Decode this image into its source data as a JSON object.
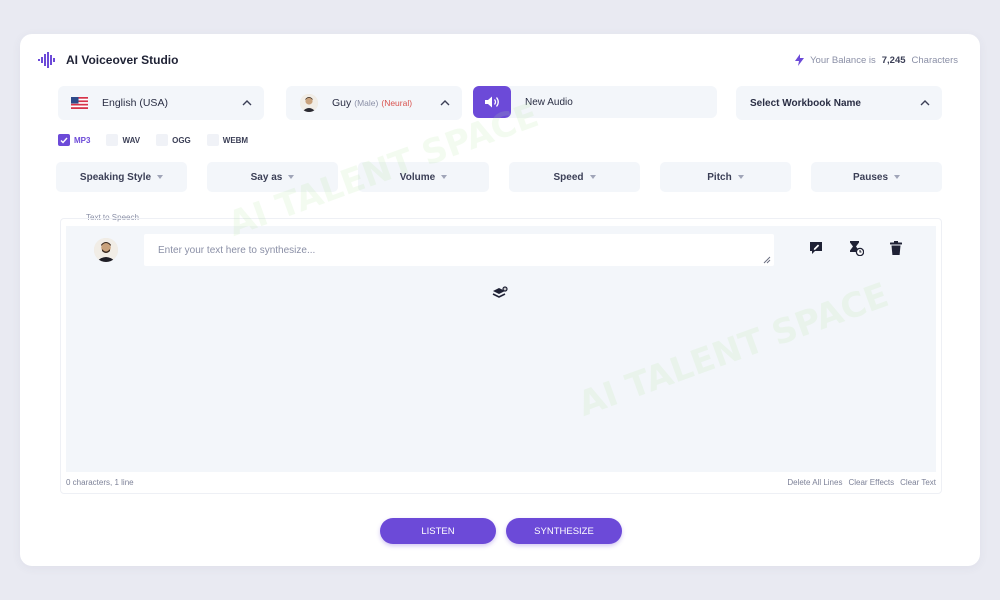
{
  "app": {
    "title": "AI Voiceover Studio"
  },
  "balance": {
    "prefix": "Your Balance is",
    "amount": "7,245",
    "unit": "Characters"
  },
  "language": {
    "label": "English (USA)"
  },
  "voice": {
    "name": "Guy",
    "gender": "(Male)",
    "type": "(Neural)"
  },
  "audio": {
    "name_value": "New Audio"
  },
  "workbook": {
    "label": "Select Workbook Name"
  },
  "formats": [
    {
      "label": "MP3",
      "selected": true
    },
    {
      "label": "WAV",
      "selected": false
    },
    {
      "label": "OGG",
      "selected": false
    },
    {
      "label": "WEBM",
      "selected": false
    }
  ],
  "options": [
    "Speaking Style",
    "Say as",
    "Volume",
    "Speed",
    "Pitch",
    "Pauses"
  ],
  "editor": {
    "section_label": "Text to Speech",
    "placeholder": "Enter your text here to synthesize...",
    "status": "0 characters, 1 line"
  },
  "footer_links": [
    "Delete All Lines",
    "Clear Effects",
    "Clear Text"
  ],
  "buttons": {
    "listen": "LISTEN",
    "synthesize": "SYNTHESIZE"
  },
  "watermark": "AI TALENT SPACE",
  "colors": {
    "accent": "#6c4ad8",
    "panel": "#f3f6fa",
    "background": "#e9eaf2",
    "neural": "#d9534f"
  },
  "icons": {
    "logo": "waveform-icon",
    "balance": "lightning-bolt-icon",
    "flag": "us-flag-icon",
    "audio": "speaker-icon",
    "tools": [
      "edit-voice-icon",
      "timer-icon",
      "trash-icon"
    ],
    "add_line": "layers-add-icon"
  }
}
